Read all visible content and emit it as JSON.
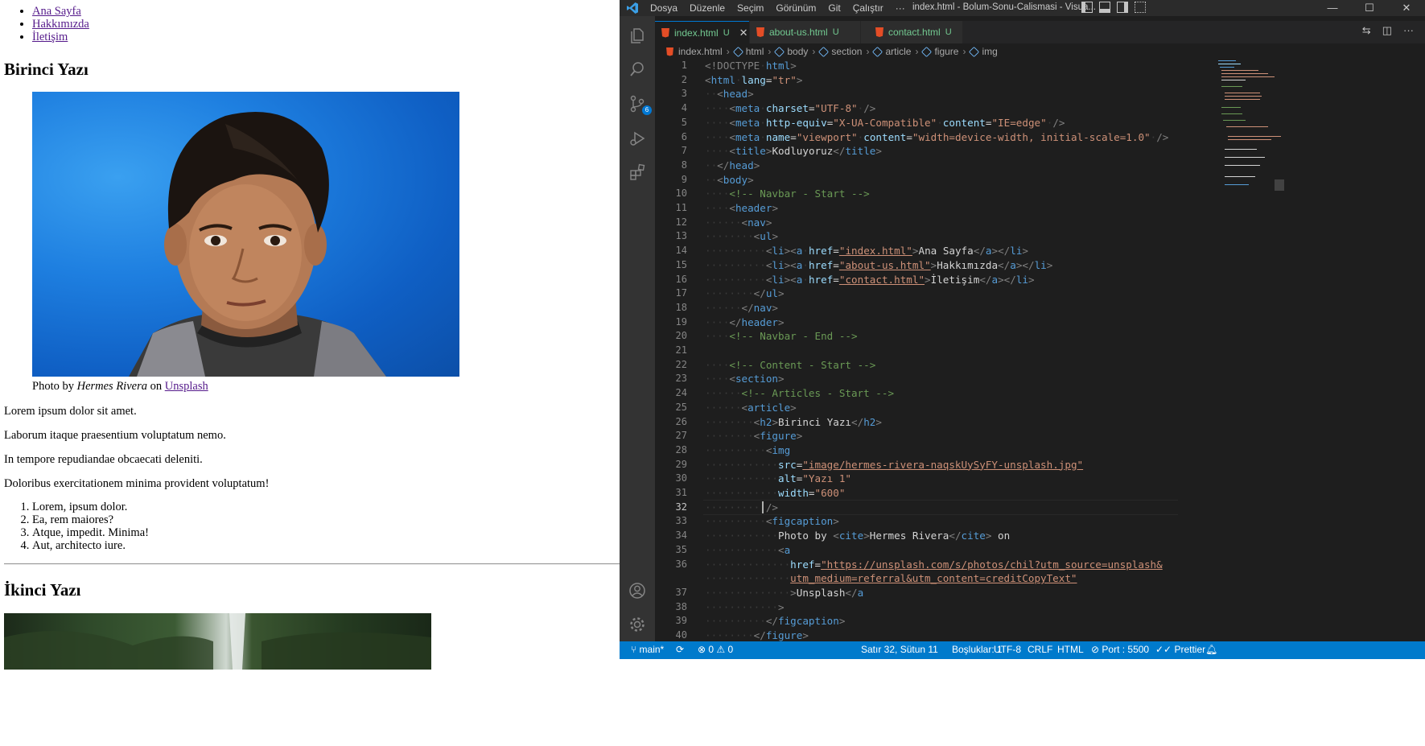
{
  "browser": {
    "nav": [
      "Ana Sayfa",
      "Hakkımızda",
      "İletişim"
    ],
    "article1": {
      "title": "Birinci Yazı",
      "caption": {
        "prefix": "Photo by ",
        "author": "Hermes Rivera",
        "middle": " on ",
        "link": "Unsplash"
      },
      "paragraphs": [
        "Lorem ipsum dolor sit amet.",
        "Laborum itaque praesentium voluptatum nemo.",
        "In tempore repudiandae obcaecati deleniti.",
        "Doloribus exercitationem minima provident voluptatum!"
      ],
      "list": [
        "Lorem, ipsum dolor.",
        "Ea, rem maiores?",
        "Atque, impedit. Minima!",
        "Aut, architecto iure."
      ]
    },
    "article2": {
      "title": "İkinci Yazı"
    }
  },
  "vscode": {
    "menu": [
      "Dosya",
      "Düzenle",
      "Seçim",
      "Görünüm",
      "Git",
      "Çalıştır",
      "···"
    ],
    "window_title": "index.html - Bolum-Sonu-Calismasi - Visua...",
    "window_controls": [
      "—",
      "☐",
      "✕"
    ],
    "source_control_badge": "6",
    "tabs": [
      {
        "name": "index.html",
        "status": "U",
        "close": "✕"
      },
      {
        "name": "about-us.html",
        "status": "U"
      },
      {
        "name": "contact.html",
        "status": "U"
      }
    ],
    "breadcrumb": [
      "index.html",
      "html",
      "body",
      "section",
      "article",
      "figure",
      "img"
    ],
    "line_numbers": [
      "1",
      "2",
      "3",
      "4",
      "5",
      "6",
      "7",
      "8",
      "9",
      "10",
      "11",
      "12",
      "13",
      "14",
      "15",
      "16",
      "17",
      "18",
      "19",
      "20",
      "21",
      "22",
      "23",
      "24",
      "25",
      "26",
      "27",
      "28",
      "29",
      "30",
      "31",
      "32",
      "33",
      "34",
      "35",
      "36",
      "",
      "37",
      "38",
      "39",
      "40"
    ],
    "current_line": "32",
    "code": {
      "l1_doctype": "<!DOCTYPE",
      "l1_html": "html",
      "l2_lang": "lang",
      "l2_lang_val": "\"tr\"",
      "l4_charset_val": "\"UTF-8\"",
      "l5_httpequiv_val": "\"X-UA-Compatible\"",
      "l5_content_val": "\"IE=edge\"",
      "l6_name_val": "\"viewport\"",
      "l6_content_val": "\"width=device-width, initial-scale=1.0\"",
      "l7_title": "Kodluyoruz",
      "l10_comment": "<!-- Navbar - Start -->",
      "l14_href": "\"index.html\"",
      "l14_text": "Ana Sayfa",
      "l15_href": "\"about-us.html\"",
      "l15_text": "Hakkımızda",
      "l16_href": "\"contact.html\"",
      "l16_text": "İletişim",
      "l20_comment": "<!-- Navbar - End -->",
      "l22_comment": "<!-- Content - Start -->",
      "l24_comment": "<!-- Articles - Start -->",
      "l26_text": "Birinci Yazı",
      "l29_src": "\"image/hermes-rivera-naqskUySyFY-unsplash.jpg\"",
      "l30_alt": "\"Yazı 1\"",
      "l31_width": "\"600\"",
      "l34_photoby": "Photo by ",
      "l34_cite": "Hermes Rivera",
      "l34_on": " on",
      "l36_href_a": "\"https://unsplash.com/s/photos/chil?utm_source=unsplash&",
      "l36_href_b": "utm_medium=referral&utm_content=creditCopyText\"",
      "l37_text": "Unsplash"
    },
    "status": {
      "branch": "main*",
      "errors": "0",
      "warnings": "0",
      "position": "Satır 32, Sütun 11",
      "spaces": "Boşluklar: 1",
      "encoding": "UTF-8",
      "eol": "CRLF",
      "language": "HTML",
      "port": "Port : 5500",
      "prettier": "Prettier"
    }
  },
  "colors": {
    "status_bar": "#007acc",
    "editor_bg": "#1e1e1e",
    "activity_bar": "#333333",
    "link": "#551a8b"
  }
}
